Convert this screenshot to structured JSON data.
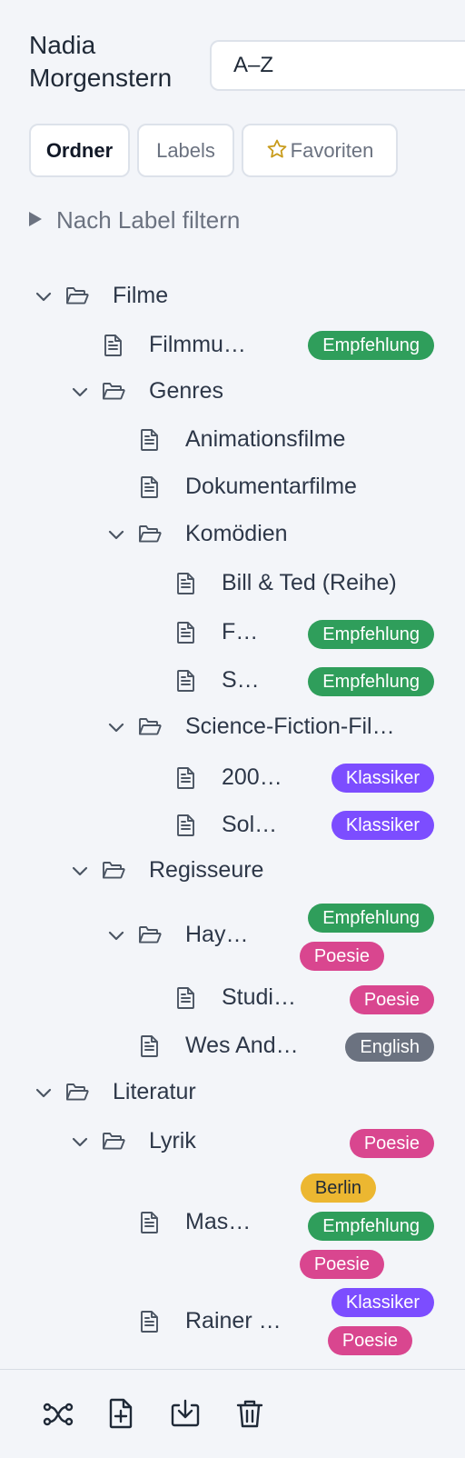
{
  "header": {
    "user_name": "Nadia Morgenstern",
    "sort_value": "A–Z"
  },
  "tabs": [
    {
      "label": "Ordner",
      "active": true
    },
    {
      "label": "Labels",
      "active": false
    },
    {
      "label": "Favoriten",
      "active": false,
      "icon": "star-icon"
    }
  ],
  "filter": {
    "label": "Nach Label filtern"
  },
  "labels": {
    "empfehlung": {
      "text": "Empfehlung",
      "color": "#2f9e5b"
    },
    "klassiker": {
      "text": "Klassiker",
      "color": "#7c4dff"
    },
    "poesie": {
      "text": "Poesie",
      "color": "#d9468f"
    },
    "english": {
      "text": "English",
      "color": "#6b7280"
    },
    "berlin": {
      "text": "Berlin",
      "color": "#ecb731"
    }
  },
  "tree": [
    {
      "type": "folder",
      "label": "Filme",
      "expanded": true
    },
    {
      "type": "file",
      "label": "Filmmu…",
      "badges": [
        "Empfehlung"
      ]
    },
    {
      "type": "folder",
      "label": "Genres",
      "expanded": true
    },
    {
      "type": "file",
      "label": "Animationsfilme"
    },
    {
      "type": "file",
      "label": "Dokumentarfilme"
    },
    {
      "type": "folder",
      "label": "Komödien",
      "expanded": true
    },
    {
      "type": "file",
      "label": "Bill & Ted (Reihe)"
    },
    {
      "type": "file",
      "label": "F…",
      "badges": [
        "Empfehlung"
      ]
    },
    {
      "type": "file",
      "label": "S…",
      "badges": [
        "Empfehlung"
      ]
    },
    {
      "type": "folder",
      "label": "Science-Fiction-Fil…",
      "expanded": true
    },
    {
      "type": "file",
      "label": "200…",
      "badges": [
        "Klassiker"
      ]
    },
    {
      "type": "file",
      "label": "Sol…",
      "badges": [
        "Klassiker"
      ]
    },
    {
      "type": "folder",
      "label": "Regisseure",
      "expanded": true
    },
    {
      "type": "folder",
      "label": "Hay…",
      "expanded": true,
      "badges": [
        "Empfehlung",
        "Poesie"
      ]
    },
    {
      "type": "file",
      "label": "Studi…",
      "badges": [
        "Poesie"
      ]
    },
    {
      "type": "file",
      "label": "Wes And…",
      "badges": [
        "English"
      ]
    },
    {
      "type": "folder",
      "label": "Literatur",
      "expanded": true
    },
    {
      "type": "folder",
      "label": "Lyrik",
      "expanded": true,
      "badges": [
        "Poesie"
      ]
    },
    {
      "type": "file",
      "label": "Mas…",
      "badges": [
        "Berlin",
        "Empfehlung",
        "Poesie"
      ]
    },
    {
      "type": "file",
      "label": "Rainer …",
      "badges": [
        "Klassiker",
        "Poesie"
      ]
    }
  ],
  "footer": {
    "icons": [
      "connect-icon",
      "new-file-icon",
      "download-icon",
      "trash-icon"
    ]
  }
}
